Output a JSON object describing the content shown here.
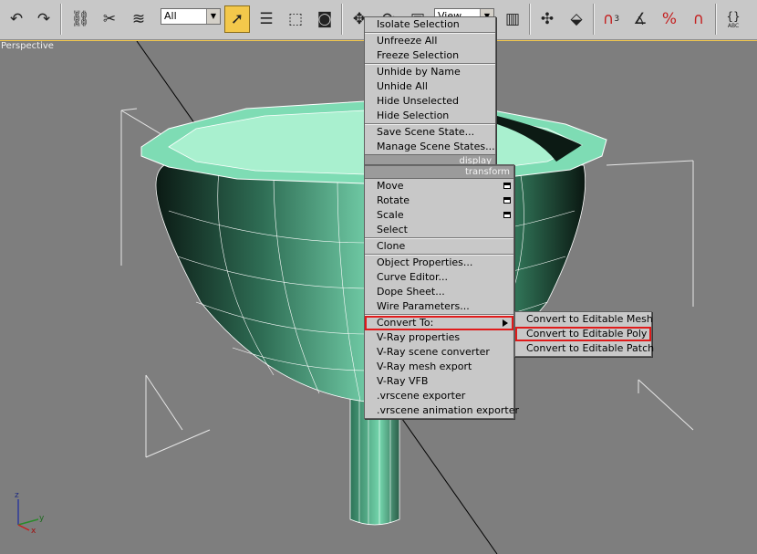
{
  "toolbar": {
    "selection_filter": "All",
    "reference_coord": "View",
    "icons": [
      "undo-icon",
      "redo-icon",
      "link-icon",
      "unlink-icon",
      "bind-space-warp-icon",
      "select-object-icon",
      "select-by-name-icon",
      "rectangle-selection-icon",
      "window-crossing-icon",
      "move-icon",
      "rotate-icon",
      "scale-icon",
      "pivot-icon",
      "manipulate-icon",
      "keyboard-shortcut-icon",
      "snap-3d-icon",
      "angle-snap-icon",
      "percent-snap-icon",
      "spinner-snap-icon",
      "named-selection-icon"
    ],
    "snap_label": "3",
    "abc_label": "ABC"
  },
  "viewport": {
    "label": "Perspective",
    "axis": {
      "x": "x",
      "y": "y",
      "z": "z"
    }
  },
  "quad_menu": {
    "display_items": [
      "Isolate Selection",
      "Unfreeze All",
      "Freeze Selection",
      "Unhide by Name",
      "Unhide All",
      "Hide Unselected",
      "Hide Selection",
      "Save Scene State...",
      "Manage Scene States..."
    ],
    "display_header": "display",
    "transform_header": "transform",
    "transform_items": [
      {
        "label": "Move",
        "has_box": true
      },
      {
        "label": "Rotate",
        "has_box": true
      },
      {
        "label": "Scale",
        "has_box": true
      },
      {
        "label": "Select",
        "has_box": false
      },
      {
        "label": "Clone",
        "has_box": false
      },
      {
        "label": "Object Properties...",
        "has_box": false
      },
      {
        "label": "Curve Editor...",
        "has_box": false
      },
      {
        "label": "Dope Sheet...",
        "has_box": false
      },
      {
        "label": "Wire Parameters...",
        "has_box": false
      },
      {
        "label": "Convert To:",
        "has_box": false,
        "has_submenu": true,
        "highlighted": true
      },
      {
        "label": "V-Ray properties",
        "has_box": false
      },
      {
        "label": "V-Ray scene converter",
        "has_box": false
      },
      {
        "label": "V-Ray mesh export",
        "has_box": false
      },
      {
        "label": "V-Ray VFB",
        "has_box": false
      },
      {
        "label": ".vrscene exporter",
        "has_box": false
      },
      {
        "label": ".vrscene animation exporter",
        "has_box": false
      }
    ],
    "convert_submenu": [
      "Convert to Editable Mesh",
      "Convert to Editable Poly",
      "Convert to Editable Patch"
    ],
    "convert_submenu_highlighted": "Convert to Editable Poly"
  },
  "colors": {
    "highlight_border": "#e01b1b",
    "active_tool": "#f3c84b",
    "object": "#6fd5a8"
  }
}
